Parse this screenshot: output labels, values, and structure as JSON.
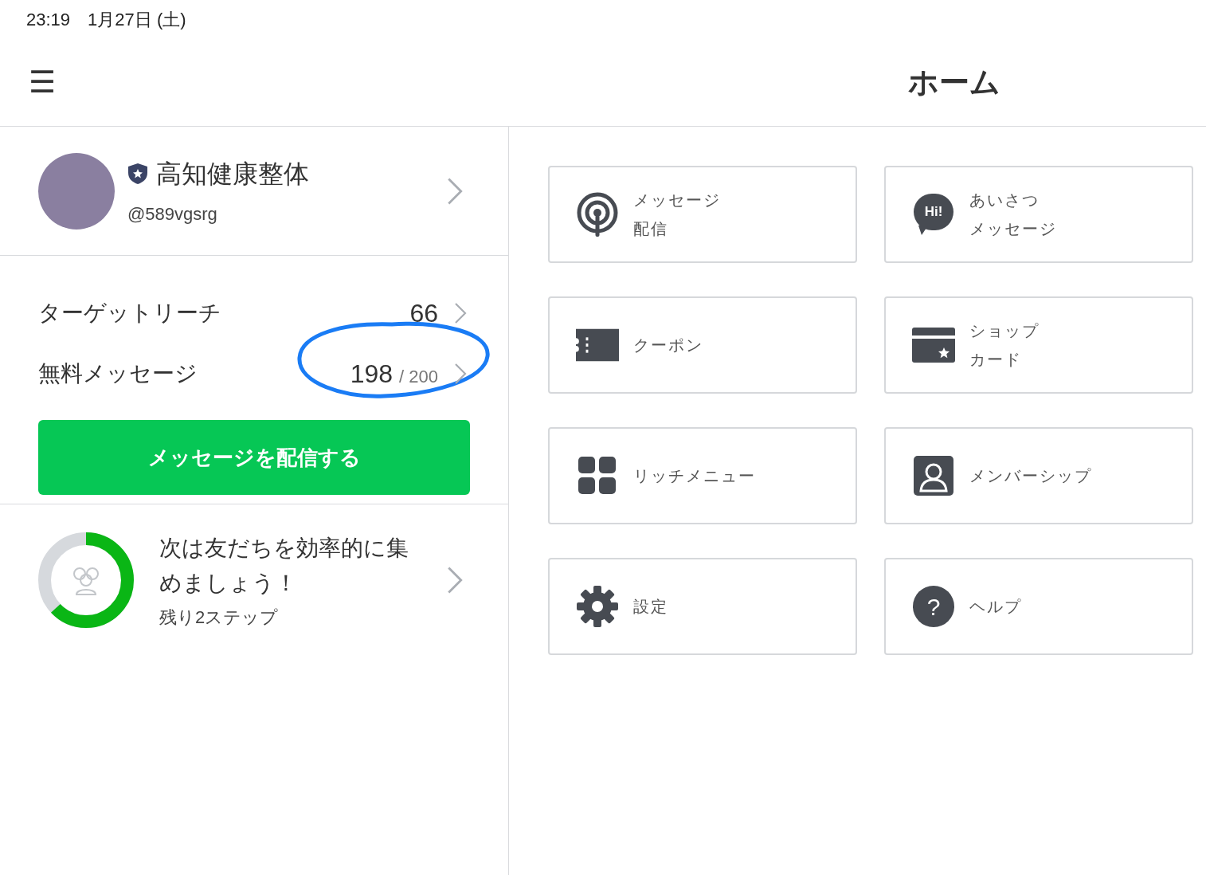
{
  "status_bar": {
    "time": "23:19",
    "date": "1月27日 (土)"
  },
  "header": {
    "menu_icon": "☰",
    "title": "ホーム"
  },
  "account": {
    "name": "高知健康整体",
    "id": "@589vgsrg"
  },
  "stats": [
    {
      "label": "ターゲットリーチ",
      "value": "66"
    },
    {
      "label": "無料メッセージ",
      "value": "198",
      "total": "/ 200"
    }
  ],
  "annotation": {
    "kind": "ellipse"
  },
  "send_button": "メッセージを配信する",
  "progress": {
    "level": 0.63,
    "title": "次は友だちを効率的に集めましょう！",
    "subtitle": "残り2ステップ"
  },
  "tiles": [
    {
      "kind": "broadcast",
      "lines": [
        "メッセージ",
        "配信"
      ]
    },
    {
      "kind": "greeting",
      "badge": "Hi!",
      "lines": [
        "あいさつ",
        "メッセージ"
      ]
    },
    {
      "kind": "coupon",
      "lines": [
        "クーポン"
      ]
    },
    {
      "kind": "shopcard",
      "lines": [
        "ショップ",
        "カード"
      ]
    },
    {
      "kind": "richmenu",
      "lines": [
        "リッチメニュー"
      ]
    },
    {
      "kind": "membership",
      "lines": [
        "メンバーシップ"
      ]
    },
    {
      "kind": "settings",
      "lines": [
        "設定"
      ]
    },
    {
      "kind": "help",
      "badge": "?",
      "lines": [
        "ヘルプ"
      ]
    }
  ]
}
